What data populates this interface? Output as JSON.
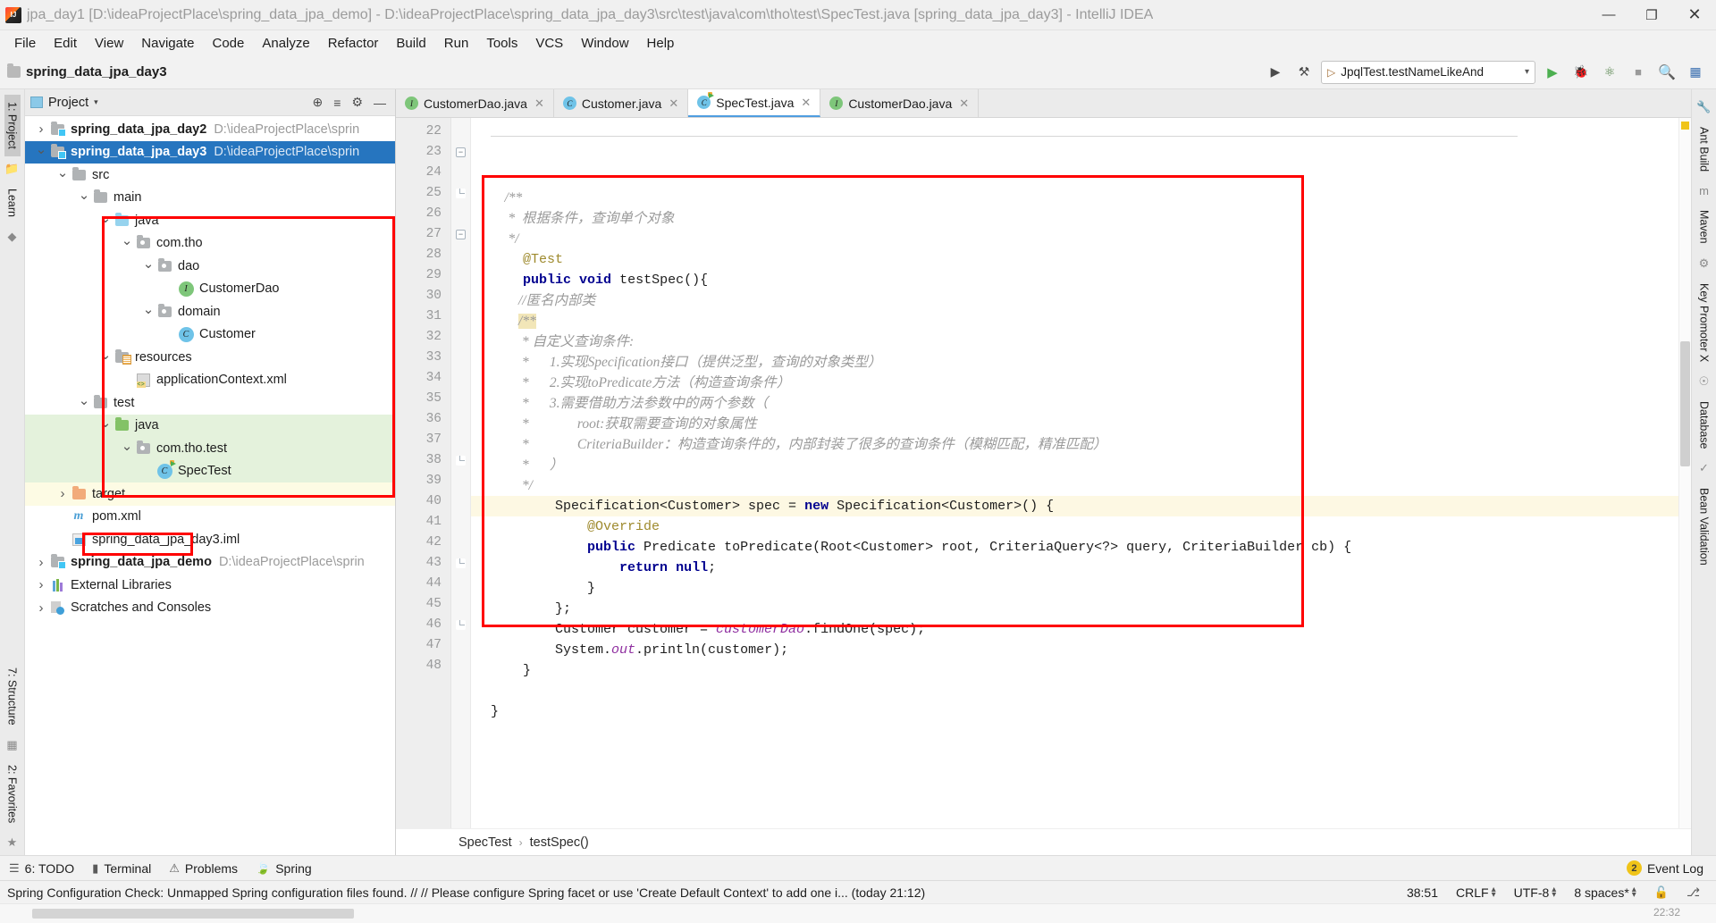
{
  "window": {
    "title": "jpa_day1 [D:\\ideaProjectPlace\\spring_data_jpa_demo] - D:\\ideaProjectPlace\\spring_data_jpa_day3\\src\\test\\java\\com\\tho\\test\\SpecTest.java [spring_data_jpa_day3] - IntelliJ IDEA",
    "minimize": "—",
    "maximize": "❐",
    "close": "✕"
  },
  "menu": [
    "File",
    "Edit",
    "View",
    "Navigate",
    "Code",
    "Analyze",
    "Refactor",
    "Build",
    "Run",
    "Tools",
    "VCS",
    "Window",
    "Help"
  ],
  "toolbar": {
    "breadcrumb": "spring_data_jpa_day3",
    "run_config": "JpqlTest.testNameLikeAnd",
    "build_icon": "▶",
    "hammer_icon": "⚒",
    "run_icon": "▶",
    "debug_icon": "🐞",
    "coverage_icon": "⭮",
    "stop_icon": "■",
    "search_icon": "🔍",
    "layout_icon": "▦"
  },
  "left_rail": {
    "items": [
      "1: Project",
      "Learn"
    ],
    "bottom_items": [
      "7: Structure",
      "2: Favorites"
    ]
  },
  "right_rail": {
    "items": [
      "Ant Build",
      "Maven",
      "Key Promoter X",
      "Database",
      "Bean Validation"
    ]
  },
  "project_panel": {
    "title": "Project",
    "caret": "▾",
    "locate_icon": "⊕",
    "collapse_icon": "≡",
    "settings_icon": "⚙",
    "hide_icon": "—",
    "tree": [
      {
        "label": "spring_data_jpa_day2",
        "path": "D:\\ideaProjectPlace\\sprin",
        "indent": 0,
        "arrow": "right",
        "icon": "module",
        "bold": true,
        "state": "normal"
      },
      {
        "label": "spring_data_jpa_day3",
        "path": "D:\\ideaProjectPlace\\sprin",
        "indent": 0,
        "arrow": "down",
        "icon": "module",
        "bold": true,
        "state": "selected"
      },
      {
        "label": "src",
        "path": "",
        "indent": 1,
        "arrow": "down",
        "icon": "folder-gray",
        "bold": false,
        "state": "normal"
      },
      {
        "label": "main",
        "path": "",
        "indent": 2,
        "arrow": "down",
        "icon": "folder-gray",
        "bold": false,
        "state": "normal"
      },
      {
        "label": "java",
        "path": "",
        "indent": 3,
        "arrow": "down",
        "icon": "folder-blue",
        "bold": false,
        "state": "normal"
      },
      {
        "label": "com.tho",
        "path": "",
        "indent": 4,
        "arrow": "down",
        "icon": "package",
        "bold": false,
        "state": "normal"
      },
      {
        "label": "dao",
        "path": "",
        "indent": 5,
        "arrow": "down",
        "icon": "package",
        "bold": false,
        "state": "normal"
      },
      {
        "label": "CustomerDao",
        "path": "",
        "indent": 6,
        "arrow": "none",
        "icon": "interface",
        "bold": false,
        "state": "normal"
      },
      {
        "label": "domain",
        "path": "",
        "indent": 5,
        "arrow": "down",
        "icon": "package",
        "bold": false,
        "state": "normal"
      },
      {
        "label": "Customer",
        "path": "",
        "indent": 6,
        "arrow": "none",
        "icon": "class",
        "bold": false,
        "state": "normal"
      },
      {
        "label": "resources",
        "path": "",
        "indent": 3,
        "arrow": "down",
        "icon": "folder-res",
        "bold": false,
        "state": "normal"
      },
      {
        "label": "applicationContext.xml",
        "path": "",
        "indent": 4,
        "arrow": "none",
        "icon": "xml",
        "bold": false,
        "state": "normal"
      },
      {
        "label": "test",
        "path": "",
        "indent": 2,
        "arrow": "down",
        "icon": "folder-gray",
        "bold": false,
        "state": "normal"
      },
      {
        "label": "java",
        "path": "",
        "indent": 3,
        "arrow": "down",
        "icon": "folder-green",
        "bold": false,
        "state": "green"
      },
      {
        "label": "com.tho.test",
        "path": "",
        "indent": 4,
        "arrow": "down",
        "icon": "package",
        "bold": false,
        "state": "green"
      },
      {
        "label": "SpecTest",
        "path": "",
        "indent": 5,
        "arrow": "none",
        "icon": "test-class",
        "bold": false,
        "state": "green"
      },
      {
        "label": "target",
        "path": "",
        "indent": 1,
        "arrow": "right",
        "icon": "folder-orange",
        "bold": false,
        "state": "yellow"
      },
      {
        "label": "pom.xml",
        "path": "",
        "indent": 1,
        "arrow": "none",
        "icon": "maven",
        "bold": false,
        "state": "normal"
      },
      {
        "label": "spring_data_jpa_day3.iml",
        "path": "",
        "indent": 1,
        "arrow": "none",
        "icon": "iml",
        "bold": false,
        "state": "normal"
      },
      {
        "label": "spring_data_jpa_demo",
        "path": "D:\\ideaProjectPlace\\sprin",
        "indent": 0,
        "arrow": "right",
        "icon": "module",
        "bold": true,
        "state": "normal"
      },
      {
        "label": "External Libraries",
        "path": "",
        "indent": 0,
        "arrow": "right",
        "icon": "libs",
        "bold": false,
        "state": "normal"
      },
      {
        "label": "Scratches and Consoles",
        "path": "",
        "indent": 0,
        "arrow": "right",
        "icon": "scratch",
        "bold": false,
        "state": "normal"
      }
    ]
  },
  "editor": {
    "tabs": [
      {
        "label": "CustomerDao.java",
        "icon": "interface",
        "active": false,
        "close": "✕"
      },
      {
        "label": "Customer.java",
        "icon": "class",
        "active": false,
        "close": "✕"
      },
      {
        "label": "SpecTest.java",
        "icon": "test-class",
        "active": true,
        "close": "✕"
      },
      {
        "label": "CustomerDao.java",
        "icon": "interface",
        "active": false,
        "close": "✕"
      }
    ],
    "first_line_number": 22,
    "lines": [
      {
        "n": 22,
        "text": "",
        "kind": "blank"
      },
      {
        "n": 23,
        "text": "    /**",
        "kind": "comment",
        "fold": "start"
      },
      {
        "n": 24,
        "text": "     *  根据条件，查询单个对象",
        "kind": "comment"
      },
      {
        "n": 25,
        "text": "     */",
        "kind": "comment",
        "fold": "end"
      },
      {
        "n": 26,
        "text": "    @Test",
        "kind": "annotation"
      },
      {
        "n": 27,
        "text": "    public void testSpec(){",
        "kind": "code",
        "fold": "start",
        "runmark": true
      },
      {
        "n": 28,
        "text": "        //匿名内部类",
        "kind": "comment"
      },
      {
        "n": 29,
        "text": "        /**",
        "kind": "comment-hl"
      },
      {
        "n": 30,
        "text": "         * 自定义查询条件:",
        "kind": "comment"
      },
      {
        "n": 31,
        "text": "         *      1.实现Specification接口（提供泛型，查询的对象类型）",
        "kind": "comment"
      },
      {
        "n": 32,
        "text": "         *      2.实现toPredicate方法（构造查询条件）",
        "kind": "comment"
      },
      {
        "n": 33,
        "text": "         *      3.需要借助方法参数中的两个参数（",
        "kind": "comment"
      },
      {
        "n": 34,
        "text": "         *              root:获取需要查询的对象属性",
        "kind": "comment"
      },
      {
        "n": 35,
        "text": "         *              CriteriaBuilder：构造查询条件的，内部封装了很多的查询条件（模糊匹配，精准匹配）",
        "kind": "comment"
      },
      {
        "n": 36,
        "text": "         *      ）",
        "kind": "comment"
      },
      {
        "n": 37,
        "text": "         */",
        "kind": "comment"
      },
      {
        "n": 38,
        "text": "        Specification<Customer> spec = new Specification<Customer>() {",
        "kind": "code",
        "highlight": true,
        "fold": "end"
      },
      {
        "n": 39,
        "text": "            @Override",
        "kind": "annotation"
      },
      {
        "n": 40,
        "text": "            public Predicate toPredicate(Root<Customer> root, CriteriaQuery<?> query, CriteriaBuilder cb) {",
        "kind": "code",
        "override": true
      },
      {
        "n": 41,
        "text": "                return null;",
        "kind": "code"
      },
      {
        "n": 42,
        "text": "            }",
        "kind": "code"
      },
      {
        "n": 43,
        "text": "        };",
        "kind": "code",
        "fold": "end"
      },
      {
        "n": 44,
        "text": "        Customer customer = customerDao.findOne(spec);",
        "kind": "code"
      },
      {
        "n": 45,
        "text": "        System.out.println(customer);",
        "kind": "code"
      },
      {
        "n": 46,
        "text": "    }",
        "kind": "code",
        "fold": "end"
      },
      {
        "n": 47,
        "text": "",
        "kind": "blank"
      },
      {
        "n": 48,
        "text": "}",
        "kind": "code"
      }
    ],
    "breadcrumbs": [
      "SpecTest",
      "testSpec()"
    ],
    "breadcrumb_sep": "›"
  },
  "tool_windows": {
    "items": [
      {
        "label": "6: TODO",
        "icon": "list-icon"
      },
      {
        "label": "Terminal",
        "icon": "terminal-icon"
      },
      {
        "label": "Problems",
        "icon": "warning-icon"
      },
      {
        "label": "Spring",
        "icon": "spring-leaf-icon"
      }
    ],
    "event_log": "Event Log",
    "event_badge": "2"
  },
  "status_bar": {
    "message": "Spring Configuration Check: Unmapped Spring configuration files found. // // Please configure Spring facet or use 'Create Default Context' to add one i... (today 21:12)",
    "caret_position": "38:51",
    "line_separator": "CRLF",
    "encoding": "UTF-8",
    "indent": "8 spaces*",
    "lock_icon": "🔓",
    "git_icon": "⎇"
  },
  "colors": {
    "accent_blue": "#2675bf",
    "annotation_red": "#ff0000",
    "selected_green": "#e4f2dc",
    "target_yellow": "#fdfbe4",
    "highlight_line": "#fdf8e3"
  },
  "bottom": {
    "coord": "22:32"
  }
}
